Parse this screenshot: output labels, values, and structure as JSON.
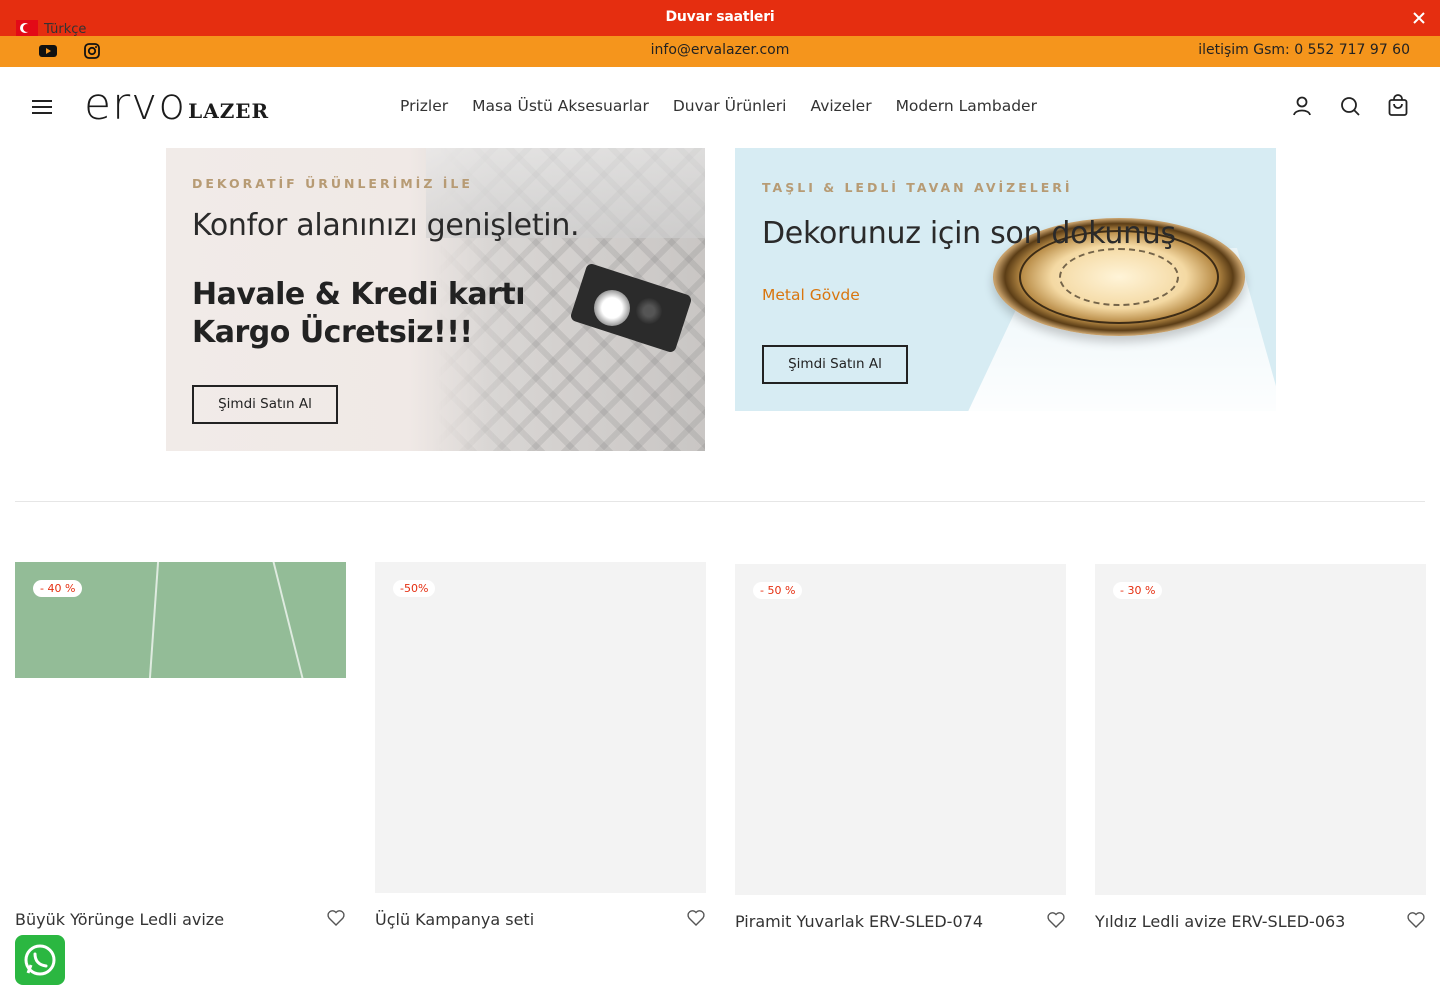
{
  "announcement": {
    "text": "Duvar saatleri",
    "close_icon": "close-icon"
  },
  "language": {
    "label": "Türkçe",
    "flag": "turkey-flag-icon"
  },
  "contact": {
    "email": "info@ervalazer.com",
    "phone": "iletişim Gsm: 0 552 717 97 60",
    "social": [
      "youtube-icon",
      "instagram-icon"
    ]
  },
  "header": {
    "logo_mark": "ervo",
    "logo_sub": "LAZER",
    "nav": [
      "Prizler",
      "Masa Üstü Aksesuarlar",
      "Duvar Ürünleri",
      "Avizeler",
      "Modern Lambader"
    ],
    "icons": [
      "account-icon",
      "search-icon",
      "cart-icon"
    ]
  },
  "banners": [
    {
      "eyebrow": "DEKORATİF ÜRÜNLERİMİZ İLE",
      "headline": "Konfor alanınızı genişletin.",
      "promo": "Havale & Kredi kartı Kargo Ücretsiz!!!",
      "button": "Şimdi Satın Al"
    },
    {
      "eyebrow": "TAŞLI & LEDLİ TAVAN AVİZELERİ",
      "headline": "Dekorunuz için son dokunuş",
      "feature": "Metal Gövde",
      "button": "Şimdi Satın Al"
    }
  ],
  "products": [
    {
      "name": "Büyük Yörünge Ledli avize",
      "badge": "- 40 %"
    },
    {
      "name": "Üçlü Kampanya seti",
      "badge": "-50%"
    },
    {
      "name": "Piramit Yuvarlak ERV-SLED-074",
      "badge": "- 50 %"
    },
    {
      "name": "Yıldız Ledli avize ERV-SLED-063",
      "badge": "- 30 %"
    }
  ],
  "colors": {
    "announcement": "#e52e10",
    "contact_bar": "#f5951c",
    "accent_gold": "#b79b74",
    "accent_orange": "#d9760f",
    "whatsapp": "#2bb741"
  }
}
